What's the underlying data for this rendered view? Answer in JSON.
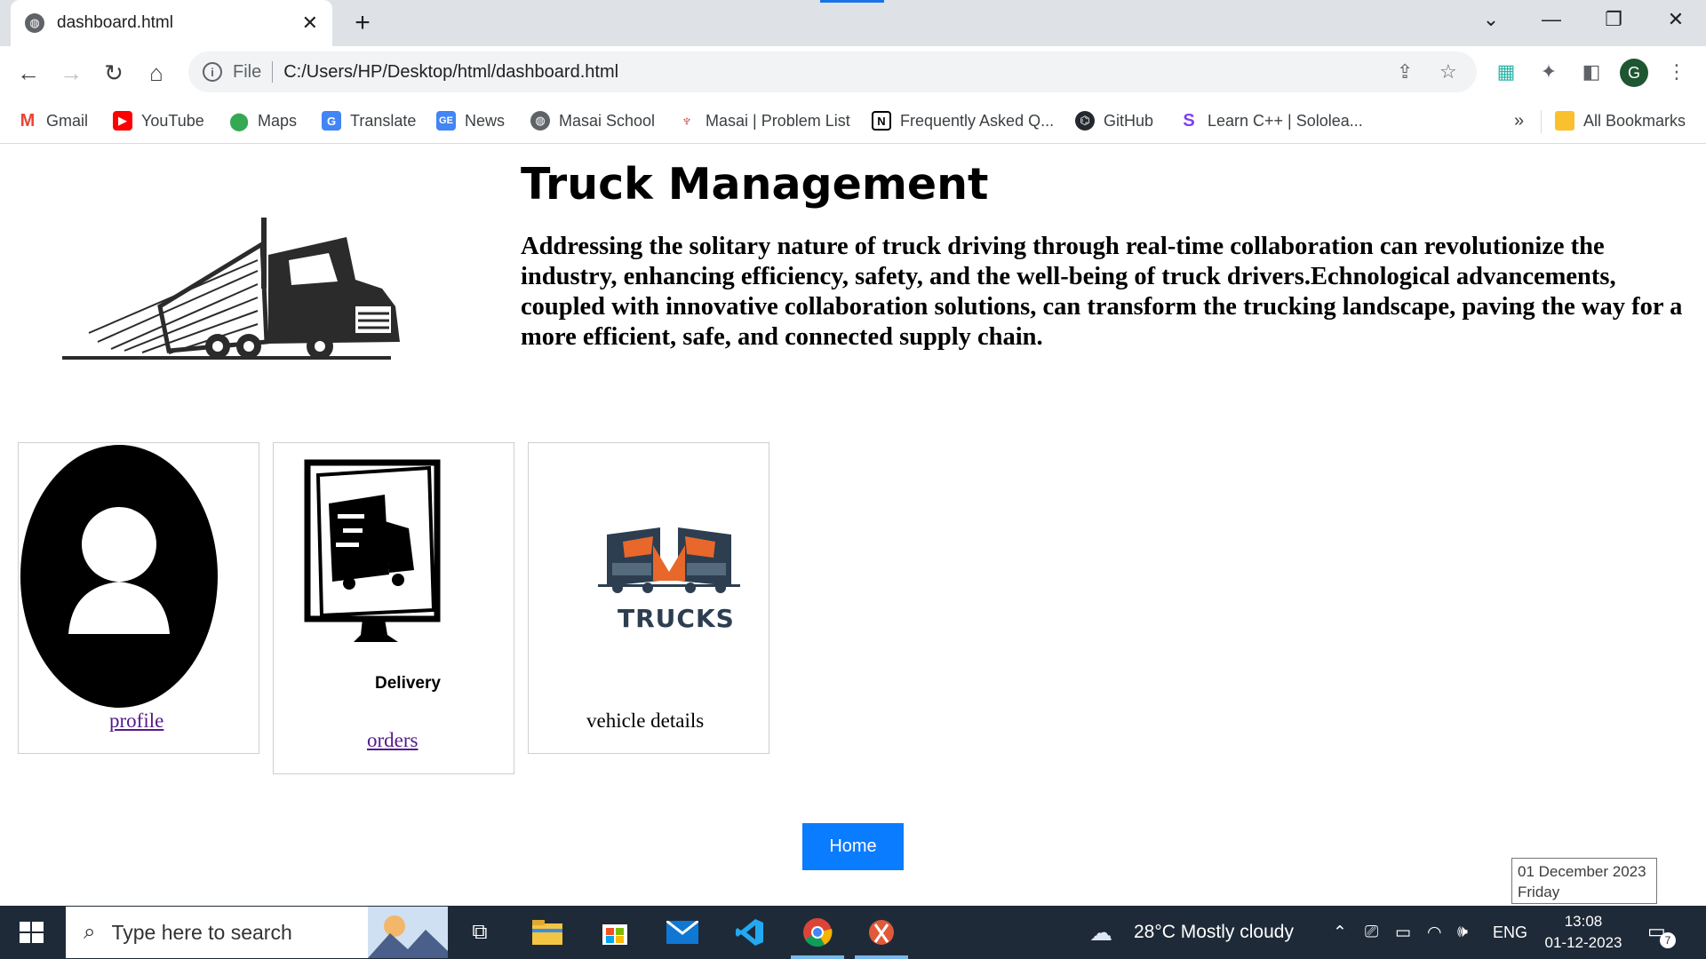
{
  "browser": {
    "tab_title": "dashboard.html",
    "new_tab": "+",
    "omnibox_scheme": "File",
    "url": "C:/Users/HP/Desktop/html/dashboard.html",
    "profile_initial": "G",
    "bookmarks": [
      {
        "label": "Gmail",
        "icon": "gmail-icon"
      },
      {
        "label": "YouTube",
        "icon": "youtube-icon"
      },
      {
        "label": "Maps",
        "icon": "maps-icon"
      },
      {
        "label": "Translate",
        "icon": "translate-icon"
      },
      {
        "label": "News",
        "icon": "news-icon"
      },
      {
        "label": "Masai School",
        "icon": "globe-icon"
      },
      {
        "label": "Masai | Problem List",
        "icon": "masai-icon"
      },
      {
        "label": "Frequently Asked Q...",
        "icon": "notion-icon"
      },
      {
        "label": "GitHub",
        "icon": "github-icon"
      },
      {
        "label": "Learn C++ | Sololea...",
        "icon": "sololearn-icon"
      }
    ],
    "overflow": "»",
    "all_bookmarks": "All Bookmarks"
  },
  "page": {
    "title": "Truck Management",
    "description": "Addressing the solitary nature of truck driving through real-time collaboration can revolutionize the industry, enhancing efficiency, safety, and the well-being of truck drivers.Echnological advancements, coupled with innovative collaboration solutions, can transform the trucking landscape, paving the way for a more efficient, safe, and connected supply chain.",
    "cards": {
      "profile": {
        "link": "profile"
      },
      "orders": {
        "image_caption": "Delivery",
        "link": "orders"
      },
      "vehicle": {
        "image_caption": "TRUCKS",
        "label": "vehicle details"
      }
    },
    "home_button": "Home"
  },
  "tooltip": {
    "date": "01 December 2023",
    "day": "Friday"
  },
  "taskbar": {
    "search_placeholder": "Type here to search",
    "weather": "28°C  Mostly cloudy",
    "language": "ENG",
    "time": "13:08",
    "date": "01-12-2023",
    "notification_count": "7"
  },
  "colors": {
    "home_button": "#0a7cff",
    "taskbar": "#1f2a38",
    "link_visited": "#551a8b"
  }
}
